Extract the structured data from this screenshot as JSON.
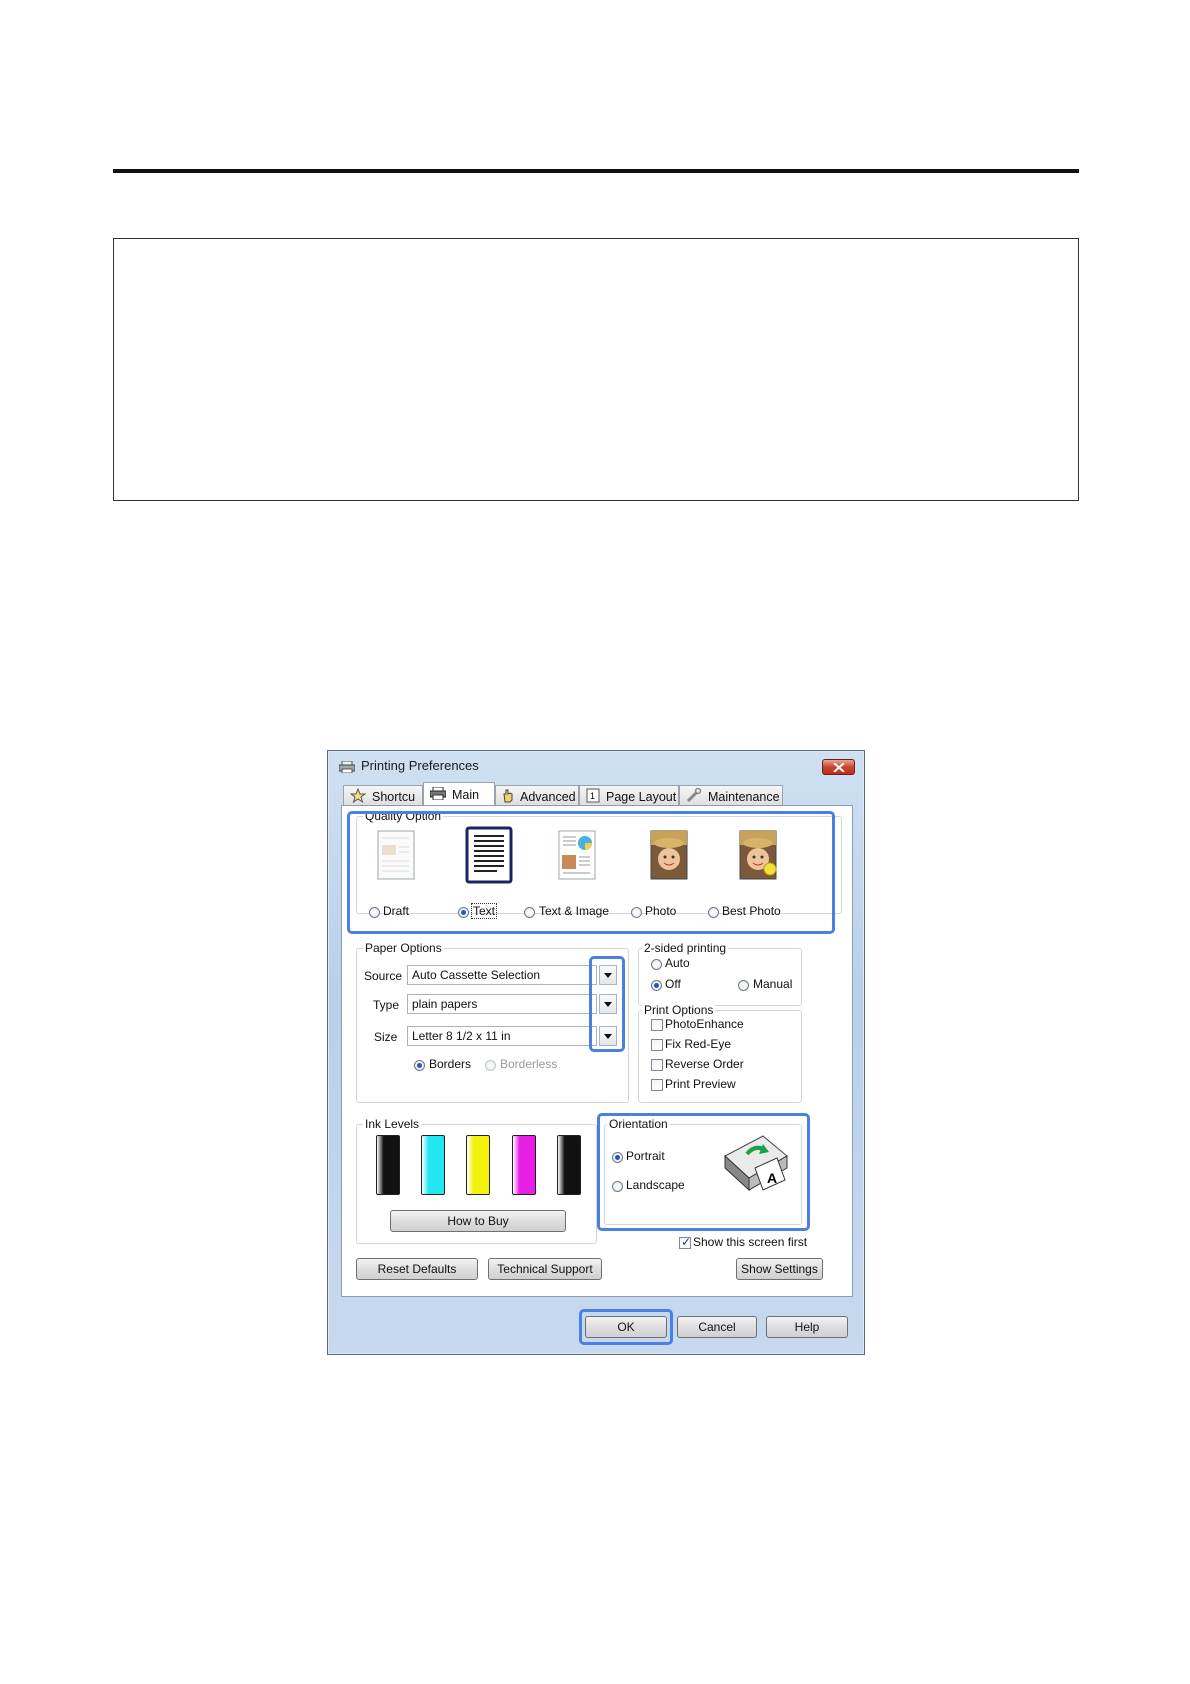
{
  "dialog": {
    "title": "Printing Preferences",
    "tabs": [
      "Shortcu",
      "Main",
      "Advanced",
      "Page Layout",
      "Maintenance"
    ],
    "active_tab": "Main"
  },
  "quality": {
    "label": "Quality Option",
    "options": [
      "Draft",
      "Text",
      "Text & Image",
      "Photo",
      "Best Photo"
    ],
    "selected": "Text"
  },
  "paper": {
    "label": "Paper Options",
    "source_label": "Source",
    "source_value": "Auto Cassette Selection",
    "type_label": "Type",
    "type_value": "plain papers",
    "size_label": "Size",
    "size_value": "Letter 8 1/2 x 11 in",
    "borders_label": "Borders",
    "borderless_label": "Borderless"
  },
  "two_sided": {
    "label": "2-sided printing",
    "auto": "Auto",
    "off": "Off",
    "manual": "Manual",
    "selected": "Off"
  },
  "print_options": {
    "label": "Print Options",
    "items": [
      "PhotoEnhance",
      "Fix Red-Eye",
      "Reverse Order",
      "Print Preview"
    ]
  },
  "ink": {
    "label": "Ink Levels",
    "colors": [
      "#111111",
      "#22e6f0",
      "#f2f20a",
      "#e61ee6",
      "#111111"
    ],
    "how_to_buy": "How to Buy"
  },
  "orientation": {
    "label": "Orientation",
    "portrait": "Portrait",
    "landscape": "Landscape",
    "selected": "Portrait"
  },
  "show_screen_first": "Show this screen first",
  "buttons": {
    "reset_defaults": "Reset Defaults",
    "technical_support": "Technical Support",
    "show_settings": "Show Settings",
    "ok": "OK",
    "cancel": "Cancel",
    "help": "Help"
  },
  "colors": {
    "highlight": "#4a7fe4"
  }
}
